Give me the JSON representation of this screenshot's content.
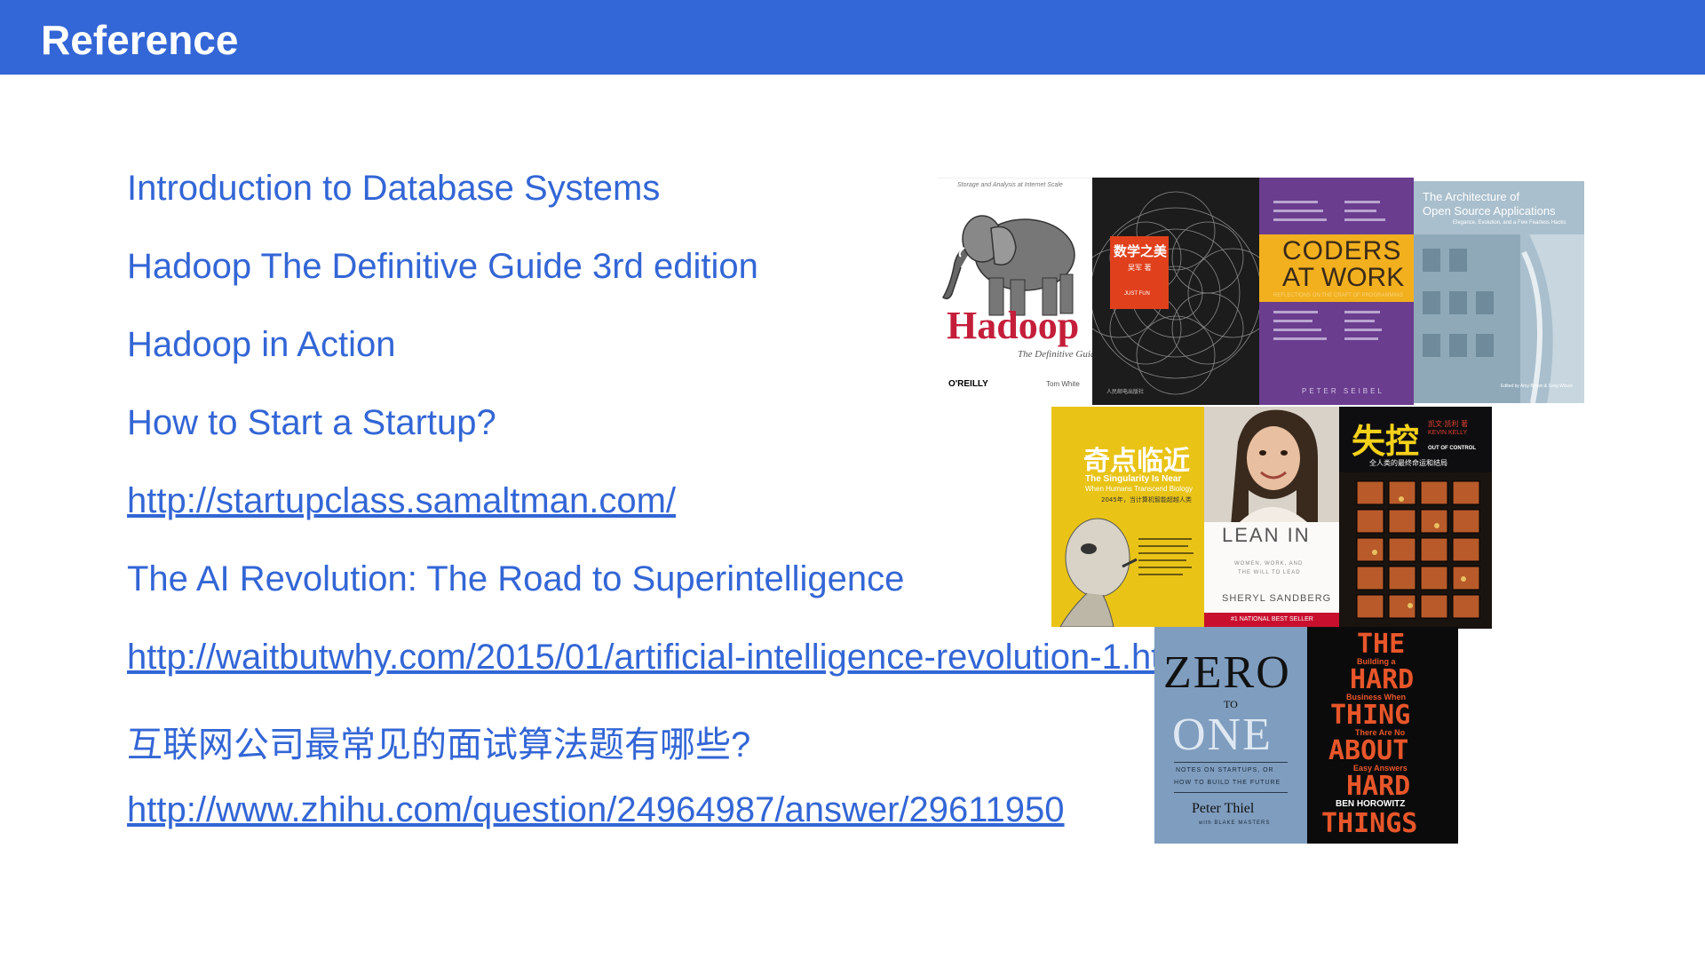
{
  "header": {
    "title": "Reference"
  },
  "references": [
    {
      "text": "Introduction to Database Systems",
      "is_link": false
    },
    {
      "text": "Hadoop The Definitive Guide 3rd edition",
      "is_link": false
    },
    {
      "text": "Hadoop in Action",
      "is_link": false
    },
    {
      "text": "How to Start a Startup?",
      "is_link": false
    },
    {
      "text": "http://startupclass.samaltman.com/",
      "is_link": true
    },
    {
      "text": "The AI Revolution: The Road to Superintelligence",
      "is_link": false
    },
    {
      "text": "http://waitbutwhy.com/2015/01/artificial-intelligence-revolution-1.html",
      "is_link": true
    },
    {
      "text": "互联网公司最常见的面试算法题有哪些?",
      "is_link": false
    },
    {
      "text": "http://www.zhihu.com/question/24964987/answer/29611950",
      "is_link": true
    }
  ],
  "books": {
    "hadoop": {
      "title": "Hadoop",
      "subtitle": "The Definitive Guide",
      "publisher": "O'REILLY",
      "author": "Tom White",
      "tagline": "Storage and Analysis at Internet Scale"
    },
    "shuxue": {
      "title": "数学之美",
      "author": "吴军 著",
      "badge": "JUST FUN",
      "publisher": "人民邮电出版社"
    },
    "coders": {
      "title_line1": "CODERS",
      "title_line2": "AT WORK",
      "subtitle": "REFLECTIONS ON THE CRAFT OF PROGRAMMING",
      "author": "PETER SEIBEL"
    },
    "aosa": {
      "title_line1": "The Architecture of",
      "title_line2": "Open Source Applications",
      "subtitle": "Elegance, Evolution, and a Few Fearless Hacks",
      "editors": "Edited by Amy Brown & Greg Wilson"
    },
    "singularity": {
      "title": "奇点临近",
      "subtitle_en1": "The Singularity Is Near",
      "subtitle_en2": "When Humans Transcend Biology",
      "tagline": "2045年，当计算机智能超越人类"
    },
    "leanin": {
      "title": "LEAN IN",
      "subtitle1": "WOMEN, WORK, AND",
      "subtitle2": "THE WILL TO LEAD",
      "author": "SHERYL SANDBERG",
      "badge": "#1 NATIONAL BEST SELLER"
    },
    "outofcontrol": {
      "title": "失控",
      "author_cn": "凯文·凯利 著",
      "author_en": "KEVIN KELLY",
      "subtitle_en": "OUT OF CONTROL",
      "subtitle_cn": "全人类的最终命运和结局"
    },
    "zerotoone": {
      "title1": "ZERO",
      "to": "TO",
      "title2": "ONE",
      "subtitle1": "NOTES ON STARTUPS, OR",
      "subtitle2": "HOW TO BUILD THE FUTURE",
      "author": "Peter Thiel",
      "coauthor": "with BLAKE MASTERS"
    },
    "hardthing": {
      "line1": "THE",
      "line1b": "Building a",
      "line2": "HARD",
      "line2b": "Business When",
      "line3": "THING",
      "line3b": "There Are No",
      "line4": "ABOUT",
      "line4b": "Easy Answers",
      "line5": "HARD",
      "author": "BEN HOROWITZ",
      "line6": "THINGS"
    }
  }
}
